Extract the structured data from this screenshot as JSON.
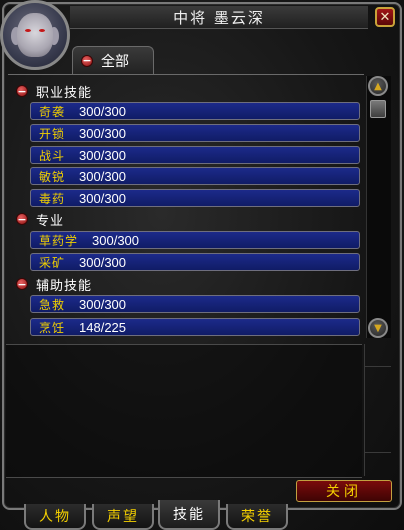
{
  "window": {
    "title": "中将 墨云深",
    "close_x": "✕"
  },
  "filter": {
    "label": "全部",
    "toggle": "−"
  },
  "categories": [
    {
      "label": "职业技能",
      "toggle": "−",
      "skills": [
        {
          "name": "奇袭",
          "value": "300/300"
        },
        {
          "name": "开锁",
          "value": "300/300"
        },
        {
          "name": "战斗",
          "value": "300/300"
        },
        {
          "name": "敏锐",
          "value": "300/300"
        },
        {
          "name": "毒药",
          "value": "300/300"
        }
      ]
    },
    {
      "label": "专业",
      "toggle": "−",
      "skills": [
        {
          "name": "草药学",
          "value": "300/300"
        },
        {
          "name": "采矿",
          "value": "300/300"
        }
      ]
    },
    {
      "label": "辅助技能",
      "toggle": "−",
      "skills": [
        {
          "name": "急救",
          "value": "300/300"
        },
        {
          "name": "烹饪",
          "value": "148/225"
        }
      ]
    }
  ],
  "close_button": "关闭",
  "tabs": [
    {
      "label": "人物",
      "active": false
    },
    {
      "label": "声望",
      "active": false
    },
    {
      "label": "技能",
      "active": true
    },
    {
      "label": "荣誉",
      "active": false
    }
  ],
  "colors": {
    "skill_name": "#f0cf00",
    "skill_bar": "#1c2a8a",
    "accent_red": "#8c1010"
  },
  "icons": {
    "scroll_up": "scroll-up-icon",
    "scroll_down": "scroll-down-icon"
  }
}
